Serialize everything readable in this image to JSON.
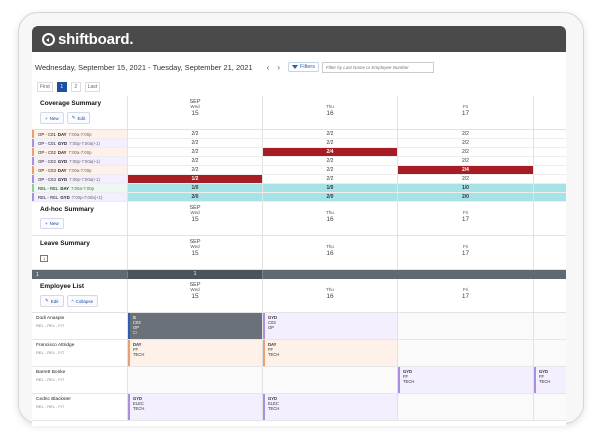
{
  "brand": {
    "name": "shiftboard."
  },
  "datebar": {
    "range": "Wednesday, September 15, 2021  -  Tuesday, September 21, 2021",
    "prev": "‹",
    "next": "›",
    "filters_label": "Filters",
    "filter_placeholder": "Filter by Last Name or Employee Number"
  },
  "pager": {
    "first": "First",
    "p1": "1",
    "p2": "2",
    "last": "Last"
  },
  "days": [
    {
      "month": "SEP",
      "dow": "Wed",
      "date": "15"
    },
    {
      "month": "",
      "dow": "Thu",
      "date": "16"
    },
    {
      "month": "",
      "dow": "Fri",
      "date": "17"
    }
  ],
  "coverage": {
    "title": "Coverage Summary",
    "new_label": "New",
    "edit_label": "Edit",
    "rows": [
      {
        "group": "OP - C01",
        "shift": "DAY",
        "time": "7:00a-7:00p",
        "v": [
          "2/2",
          "2/2",
          "2/2"
        ]
      },
      {
        "group": "OP - C01",
        "shift": "GYD",
        "time": "7:00p-7:00a(+1)",
        "v": [
          "2/2",
          "2/2",
          "2/2"
        ]
      },
      {
        "group": "OP - C02",
        "shift": "DAY",
        "time": "7:00a-7:00p",
        "v": [
          "2/2",
          "2/4",
          "2/2"
        ]
      },
      {
        "group": "OP - C02",
        "shift": "GYD",
        "time": "7:00p-7:00a(+1)",
        "v": [
          "2/2",
          "2/2",
          "2/2"
        ]
      },
      {
        "group": "OP - C03",
        "shift": "DAY",
        "time": "7:00a-7:00p",
        "v": [
          "2/2",
          "2/2",
          "2/4"
        ]
      },
      {
        "group": "OP - C03",
        "shift": "GYD",
        "time": "7:00p-7:00a(+1)",
        "v": [
          "1/2",
          "2/2",
          "2/2"
        ]
      },
      {
        "group": "REL - REL",
        "shift": "DAY",
        "time": "7:00a-7:00p",
        "v": [
          "1/0",
          "1/0",
          "1/0"
        ]
      },
      {
        "group": "REL - REL",
        "shift": "GYD",
        "time": "7:00p-7:00a(+1)",
        "v": [
          "2/0",
          "2/0",
          "2/0"
        ]
      }
    ]
  },
  "adhoc": {
    "title": "Ad-hoc Summary",
    "new_label": "New"
  },
  "leave": {
    "title": "Leave Summary",
    "badge": "1",
    "bar_label": "1",
    "bar_value": "1"
  },
  "employees": {
    "title": "Employee List",
    "edit_label": "Edit",
    "collapse_label": "Collapse",
    "rows": [
      {
        "name": "Dodi Anaspie",
        "sub": "REL - REL - F/T",
        "s1": {
          "l1": "S",
          "l2": "C03",
          "l3": "OP",
          "l4": "☐"
        },
        "s2": {
          "l1": "GYD",
          "l2": "C03",
          "l3": "OP"
        }
      },
      {
        "name": "Francisco Attridge",
        "sub": "REL - REL - F/T",
        "s1": {
          "l1": "DAY",
          "l2": "FF",
          "l3": "TECH"
        },
        "s2": {
          "l1": "DAY",
          "l2": "FF",
          "l3": "TECH"
        }
      },
      {
        "name": "Barrett Bonke",
        "sub": "REL - REL - F/T",
        "s3": {
          "l1": "GYD",
          "l2": "FF",
          "l3": "TECH"
        },
        "s4": {
          "l1": "GYD",
          "l2": "FF",
          "l3": "TECH"
        }
      },
      {
        "name": "Cedric Blackster",
        "sub": "REL - REL - F/T",
        "s1": {
          "l1": "GYD",
          "l2": "ELEC",
          "l3": "TECH"
        },
        "s2": {
          "l1": "GYD",
          "l2": "ELEC",
          "l3": "TECH"
        }
      }
    ]
  }
}
